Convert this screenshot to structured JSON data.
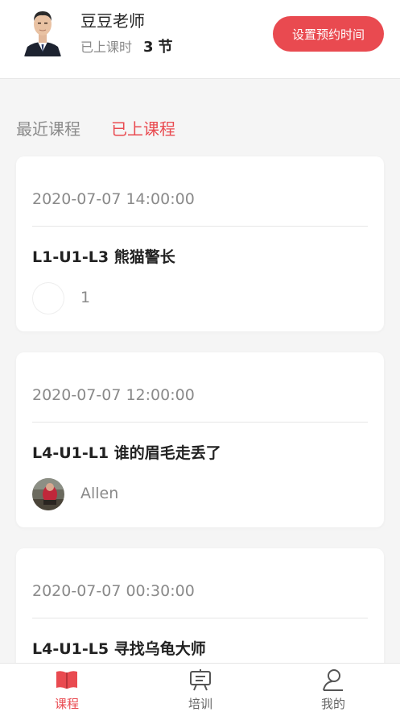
{
  "header": {
    "teacher_name": "豆豆老师",
    "lessons_label": "已上课时",
    "lessons_count": "3",
    "lessons_unit": "节",
    "schedule_button": "设置预约时间"
  },
  "tabs": [
    {
      "label": "最近课程",
      "active": false
    },
    {
      "label": "已上课程",
      "active": true
    }
  ],
  "courses": [
    {
      "time": "2020-07-07 14:00:00",
      "title": "L1-U1-L3 熊猫警长",
      "student": "1",
      "avatar": "blank"
    },
    {
      "time": "2020-07-07 12:00:00",
      "title": "L4-U1-L1 谁的眉毛走丢了",
      "student": "Allen",
      "avatar": "photo"
    },
    {
      "time": "2020-07-07 00:30:00",
      "title": "L4-U1-L5 寻找乌龟大师",
      "student": "",
      "avatar": "none"
    }
  ],
  "tabbar": [
    {
      "label": "课程",
      "icon": "book-icon",
      "active": true
    },
    {
      "label": "培训",
      "icon": "training-icon",
      "active": false
    },
    {
      "label": "我的",
      "icon": "profile-icon",
      "active": false
    }
  ],
  "colors": {
    "accent": "#e94a50",
    "muted": "#8a8a8a",
    "background": "#f5f5f5"
  }
}
